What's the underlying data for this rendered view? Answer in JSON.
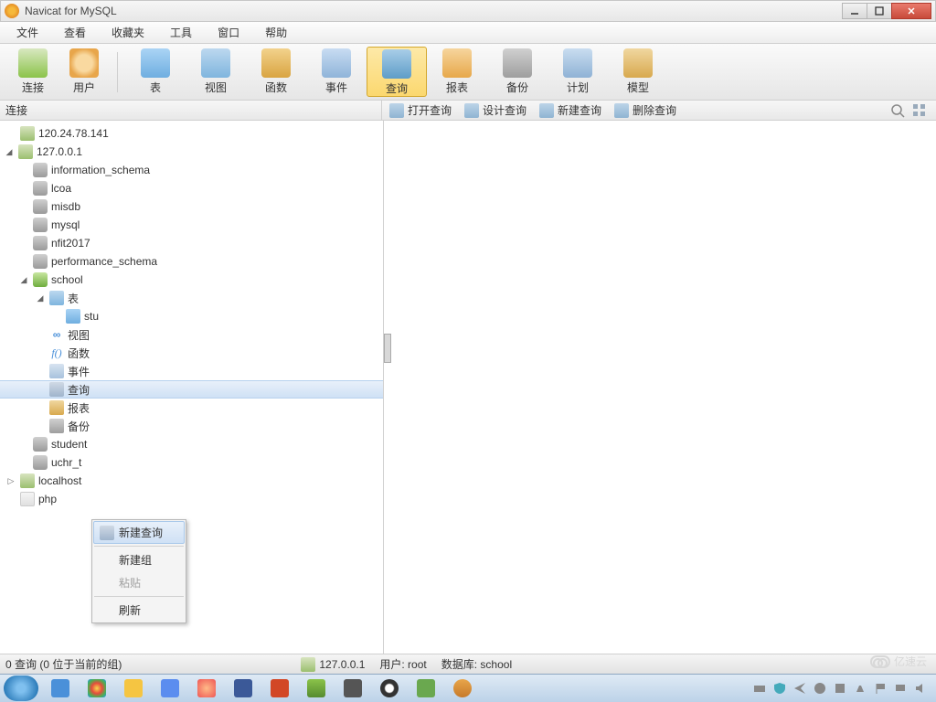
{
  "title": "Navicat for MySQL",
  "menu": [
    "文件",
    "查看",
    "收藏夹",
    "工具",
    "窗口",
    "帮助"
  ],
  "toolbar": [
    {
      "label": "连接"
    },
    {
      "label": "用户"
    },
    {
      "label": "表"
    },
    {
      "label": "视图"
    },
    {
      "label": "函数"
    },
    {
      "label": "事件"
    },
    {
      "label": "查询"
    },
    {
      "label": "报表"
    },
    {
      "label": "备份"
    },
    {
      "label": "计划"
    },
    {
      "label": "模型"
    }
  ],
  "sub": {
    "left": "连接",
    "open": "打开查询",
    "design": "设计查询",
    "new": "新建查询",
    "del": "删除查询"
  },
  "tree": {
    "conn1": "120.24.78.141",
    "conn2": "127.0.0.1",
    "dbs": [
      "information_schema",
      "lcoa",
      "misdb",
      "mysql",
      "nfit2017",
      "performance_schema"
    ],
    "school": "school",
    "school_items": {
      "tables": "表",
      "stu": "stu",
      "views": "视图",
      "funcs": "函数",
      "events": "事件",
      "queries": "查询",
      "reports": "报表",
      "backup": "备份"
    },
    "dbs2": [
      "student",
      "uchr_t"
    ],
    "conn3": "localhost",
    "php": "php"
  },
  "ctx": [
    "新建查询",
    "新建组",
    "粘贴",
    "刷新"
  ],
  "status": {
    "left": "0 查询 (0 位于当前的组)",
    "host": "127.0.0.1",
    "user": "用户: root",
    "db": "数据库: school"
  },
  "watermark": "亿速云"
}
